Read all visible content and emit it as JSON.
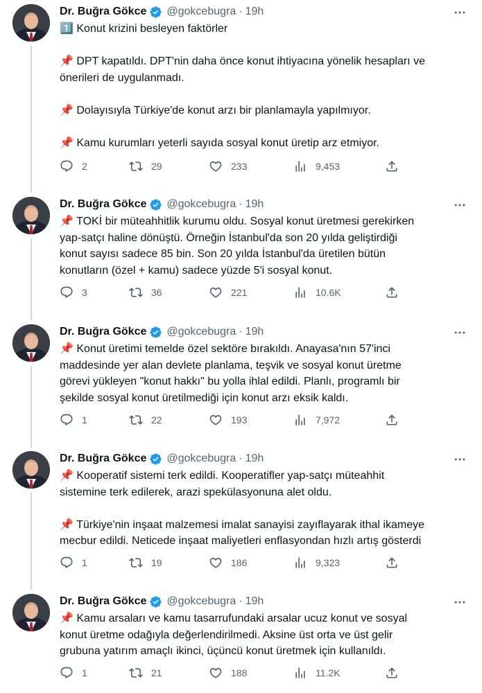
{
  "author": {
    "name": "Dr. Buğra Gökce",
    "handle": "@gokcebugra",
    "separator": "·",
    "time": "19h"
  },
  "tweets": [
    {
      "lines": [
        "1️⃣ Konut krizini besleyen faktörler",
        "",
        "📌 DPT kapatıldı. DPT'nin daha önce konut ihtiyacına yönelik hesapları ve",
        "önerileri de uygulanmadı.",
        "",
        "📌 Dolayısıyla Türkiye'de konut arzı bir planlamayla yapılmıyor.",
        "",
        "📌 Kamu kurumları yeterli sayıda sosyal konut üretip arz etmiyor."
      ],
      "replies": "2",
      "retweets": "29",
      "likes": "233",
      "views": "9,453"
    },
    {
      "lines": [
        "📌 TOKİ bir müteahhitlik kurumu oldu. Sosyal konut üretmesi gerekirken",
        "yap-satçı haline dönüştü. Örneğin İstanbul'da son 20 yılda geliştirdiği",
        "konut sayısı sadece 85 bin. Son 20 yılda İstanbul'da üretilen bütün",
        "konutların (özel + kamu) sadece yüzde 5'i sosyal konut."
      ],
      "replies": "3",
      "retweets": "36",
      "likes": "221",
      "views": "10.6K"
    },
    {
      "lines": [
        "📌 Konut üretimi temelde özel sektöre bırakıldı. Anayasa'nın 57'inci",
        "maddesinde yer alan devlete planlama, teşvik ve sosyal konut üretme",
        "görevi yükleyen \"konut hakkı\" bu yolla ihlal edildi. Planlı, programlı bir",
        "şekilde sosyal konut üretilmediği için konut arzı eksik kaldı."
      ],
      "replies": "1",
      "retweets": "22",
      "likes": "193",
      "views": "7,972"
    },
    {
      "lines": [
        "📌 Kooperatif sistemi terk edildi. Kooperatifler yap-satçı müteahhit",
        "sistemine terk edilerek, arazi spekülasyonuna alet oldu.",
        "",
        "📌 Türkiye'nin inşaat malzemesi imalat sanayisi zayıflayarak ithal ikameye",
        "mecbur edildi. Neticede inşaat maliyetleri enflasyondan hızlı artış gösterdi"
      ],
      "replies": "1",
      "retweets": "19",
      "likes": "186",
      "views": "9,323"
    },
    {
      "lines": [
        "📌 Kamu arsaları ve kamu tasarrufundaki arsalar ucuz konut ve sosyal",
        "konut üretme odağıyla değerlendirilmedi. Aksine üst orta ve üst gelir",
        "grubuna yatırım amaçlı ikinci, üçüncü konut üretmek için kullanıldı."
      ],
      "replies": "1",
      "retweets": "21",
      "likes": "188",
      "views": "11.2K"
    }
  ],
  "colors": {
    "text": "#0f1419",
    "secondary": "#536471",
    "verified": "#1d9bf0",
    "thread_line": "#cfd9de"
  },
  "icons": {
    "verified": "verified-badge-icon",
    "more": "more-dots-icon",
    "reply": "reply-icon",
    "retweet": "retweet-icon",
    "like": "heart-icon",
    "views": "views-chart-icon",
    "share": "share-icon"
  }
}
